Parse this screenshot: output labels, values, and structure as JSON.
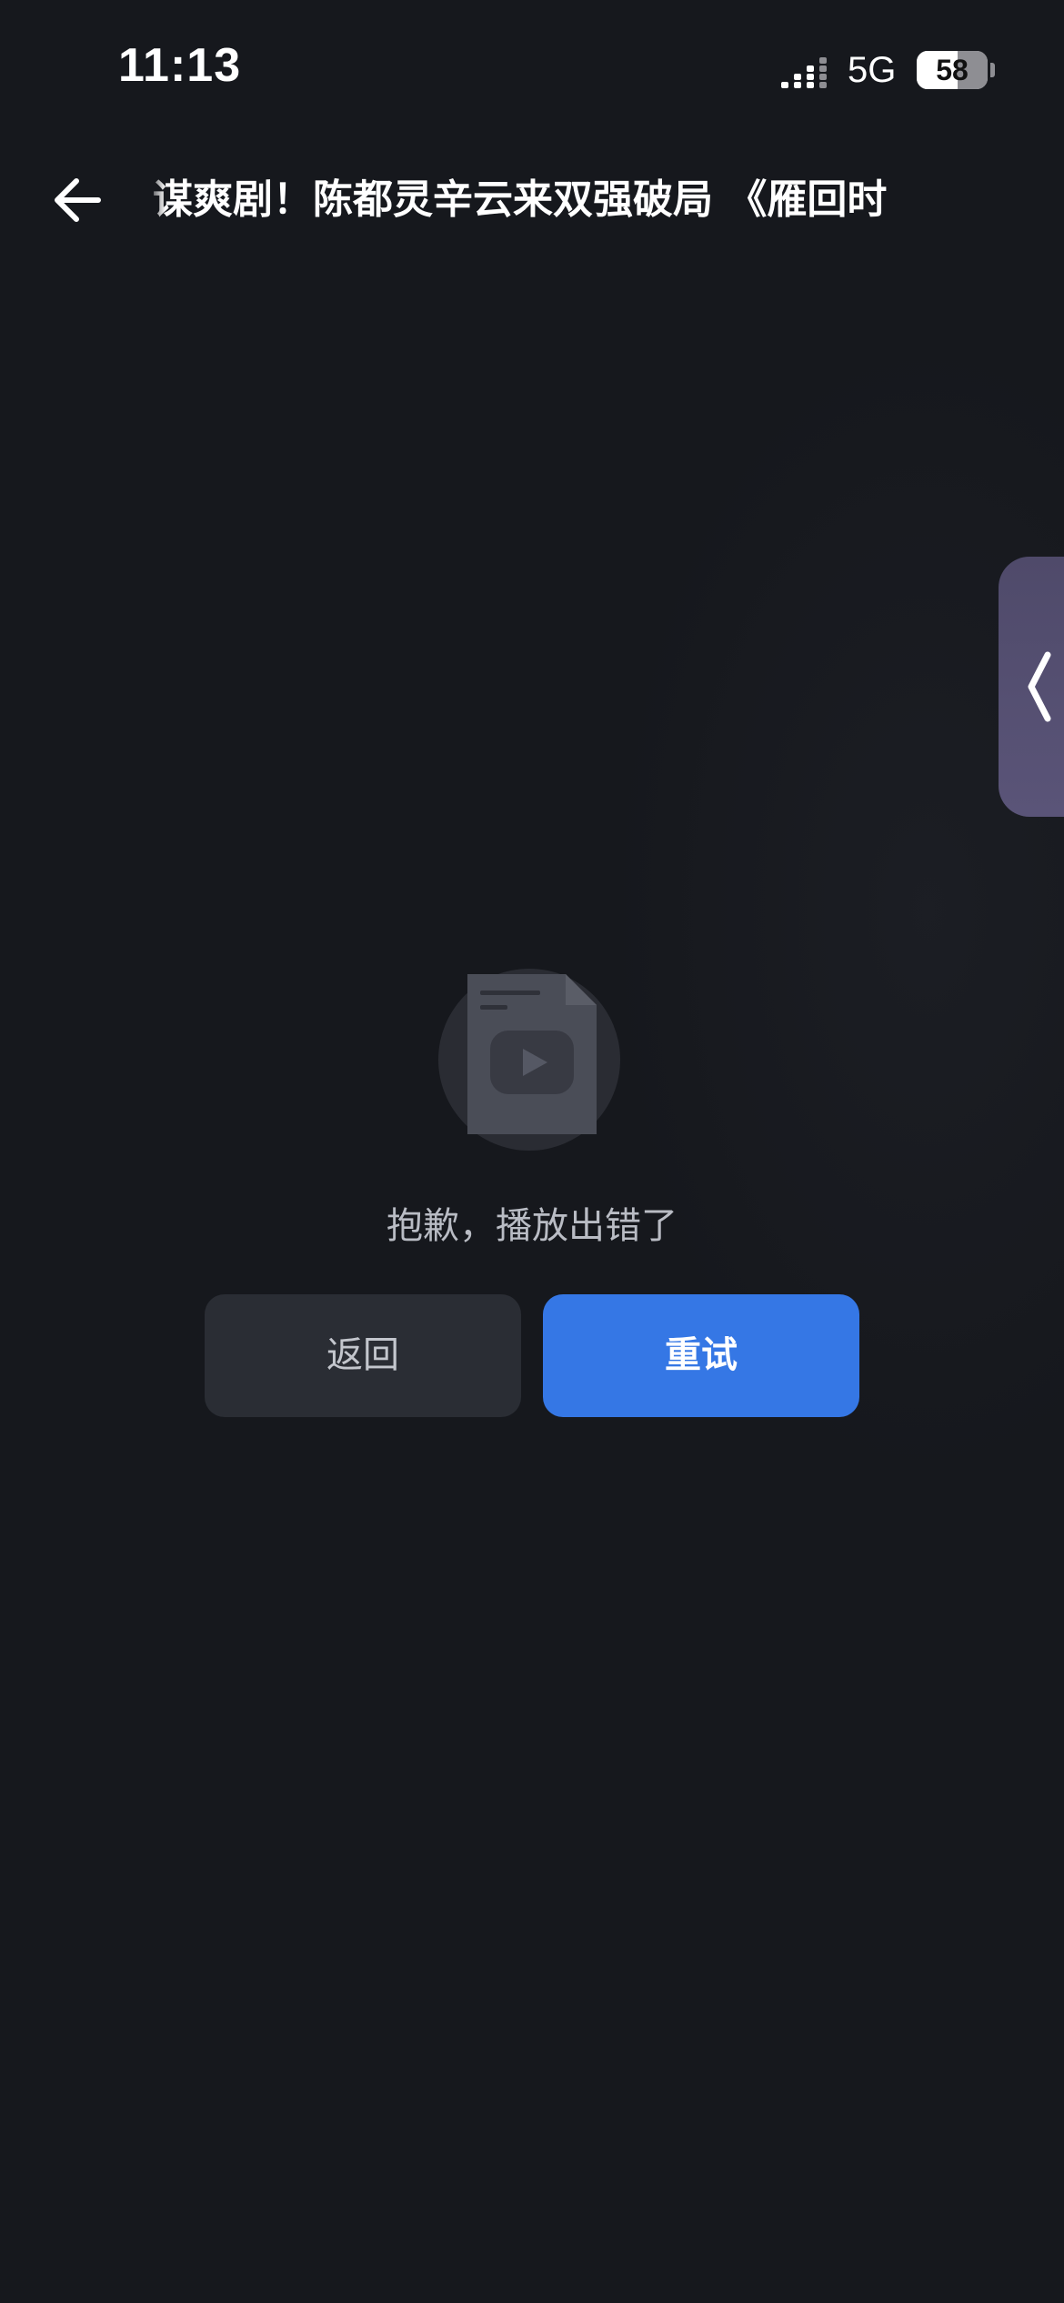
{
  "status_bar": {
    "time": "11:13",
    "network": "5G",
    "battery_level": "58",
    "battery_percent": 58,
    "signal_bars_active": 3,
    "signal_bars_total": 4
  },
  "header": {
    "title": "谋爽剧！陈都灵辛云来双强破局 《雁回时"
  },
  "error": {
    "message": "抱歉，播放出错了",
    "back_label": "返回",
    "retry_label": "重试"
  },
  "colors": {
    "background": "#16181d",
    "primary": "#3577e5",
    "secondary_button": "#2a2d34",
    "side_handle": "#544e70"
  },
  "icons": {
    "back": "arrow-left-icon",
    "side_handle": "chevron-left-icon",
    "error": "video-file-icon",
    "signal": "signal-icon"
  }
}
